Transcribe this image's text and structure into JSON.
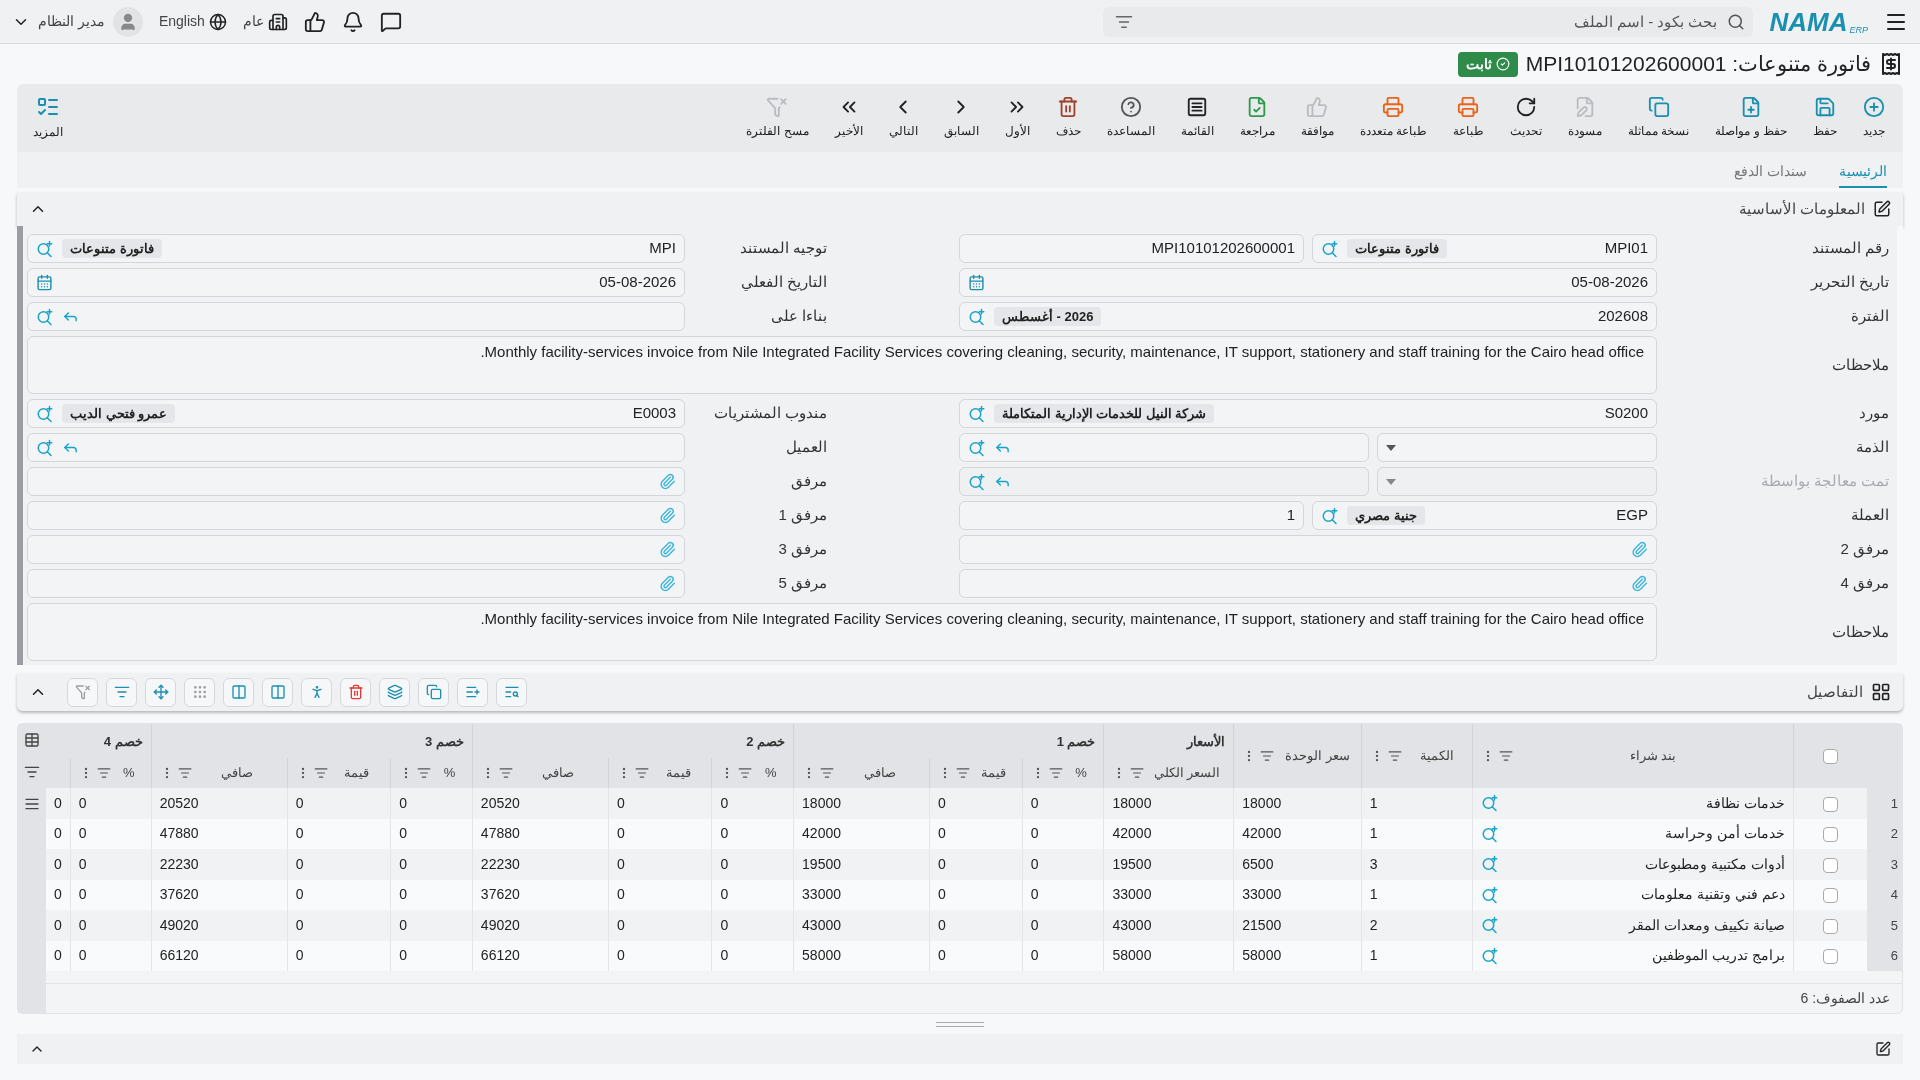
{
  "header": {
    "logo": "NAMA",
    "logo_sub": "ERP",
    "search": {
      "placeholder": "بحث بكود - اسم الملف"
    },
    "company": "عام",
    "language": "English",
    "user": "مدير النظام"
  },
  "page": {
    "title": "فاتورة متنوعات: MPI10101202600001",
    "status": "ثابت"
  },
  "toolbar": [
    {
      "label": "جديد",
      "color": "#1a8fb0"
    },
    {
      "label": "حفظ",
      "color": "#1a8fb0"
    },
    {
      "label": "حفظ و مواصلة",
      "color": "#1a8fb0"
    },
    {
      "label": "نسخة مماثلة",
      "color": "#1a8fb0"
    },
    {
      "label": "مسودة",
      "color": "#b9bcc1"
    },
    {
      "label": "تحديث",
      "color": "#222222"
    },
    {
      "label": "طباعة",
      "color": "#e8641b"
    },
    {
      "label": "طباعة متعددة",
      "color": "#e8641b"
    },
    {
      "label": "موافقة",
      "color": "#b9bcc1"
    },
    {
      "label": "مراجعة",
      "color": "#2e9a4a"
    },
    {
      "label": "القائمة",
      "color": "#222222"
    },
    {
      "label": "المساعدة",
      "color": "#555555"
    },
    {
      "label": "حذف",
      "color": "#a0402a"
    },
    {
      "label": "الأول",
      "color": "#222222"
    },
    {
      "label": "السابق",
      "color": "#222222"
    },
    {
      "label": "التالي",
      "color": "#222222"
    },
    {
      "label": "الأخير",
      "color": "#222222"
    },
    {
      "label": "مسح الفلترة",
      "color": "#b9bcc1"
    }
  ],
  "more": "المزيد",
  "tabs": [
    {
      "label": "الرئيسية",
      "selected": true
    },
    {
      "label": "سندات الدفع",
      "selected": false
    }
  ],
  "basic_info": {
    "title": "المعلومات الأساسية",
    "rows": [
      {
        "kind": "pair",
        "right": {
          "kind": "code",
          "label": "رقم المستند",
          "value": "MPI01",
          "tag": "فاتورة متنوعات",
          "second": "MPI10101202600001"
        },
        "left": {
          "kind": "code",
          "label": "توجيه المستند",
          "value": "MPI",
          "tag": "فاتورة متنوعات"
        }
      },
      {
        "kind": "pair",
        "right": {
          "kind": "date",
          "label": "تاريخ التحرير",
          "value": "05-08-2026"
        },
        "left": {
          "kind": "date",
          "label": "التاريخ الفعلي",
          "value": "05-08-2026"
        }
      },
      {
        "kind": "pair",
        "right": {
          "kind": "code",
          "label": "الفترة",
          "value": "202608",
          "tag": "2026 - أغسطس"
        },
        "left": {
          "kind": "link",
          "label": "بناءا على"
        }
      },
      {
        "kind": "notes",
        "label": "ملاحظات",
        "value": "Monthly facility-services invoice from Nile Integrated Facility Services covering cleaning, security, maintenance, IT support, stationery and staff training for the Cairo head office."
      },
      {
        "kind": "pair",
        "right": {
          "kind": "code",
          "label": "مورد",
          "value": "S0200",
          "tag": "شركة النيل للخدمات الإدارية المتكاملة"
        },
        "left": {
          "kind": "code",
          "label": "مندوب المشتريات",
          "value": "E0003",
          "tag": "عمرو فتحي الديب"
        }
      },
      {
        "kind": "pair",
        "right": {
          "kind": "select_link",
          "label": "الذمة",
          "disabled": false
        },
        "left": {
          "kind": "link",
          "label": "العميل"
        }
      },
      {
        "kind": "pair",
        "right": {
          "kind": "select_link",
          "label": "تمت معالجة بواسطة",
          "disabled": true
        },
        "left": {
          "kind": "attach",
          "label": "مرفق"
        }
      },
      {
        "kind": "pair",
        "right": {
          "kind": "code",
          "label": "العملة",
          "value": "EGP",
          "tag": "جنية مصري",
          "second": "1"
        },
        "left": {
          "kind": "attach",
          "label": "مرفق 1"
        }
      },
      {
        "kind": "pair",
        "right": {
          "kind": "attach",
          "label": "مرفق 2"
        },
        "left": {
          "kind": "attach",
          "label": "مرفق 3"
        }
      },
      {
        "kind": "pair",
        "right": {
          "kind": "attach",
          "label": "مرفق 4"
        },
        "left": {
          "kind": "attach",
          "label": "مرفق 5"
        }
      },
      {
        "kind": "notes",
        "label": "ملاحظات",
        "value": "Monthly facility-services invoice from Nile Integrated Facility Services covering cleaning, security, maintenance, IT support, stationery and staff training for the Cairo head office."
      }
    ]
  },
  "details": {
    "title": "التفاصيل",
    "table": {
      "all_checked": false,
      "columns": [
        {
          "label": "بند شراء"
        },
        {
          "label": "الكمية"
        },
        {
          "label": "سعر الوحدة"
        },
        {
          "label": "الأسعار",
          "children": [
            "السعر الكلي"
          ]
        },
        {
          "label": "خصم 1",
          "colspan": 3,
          "children": [
            "%",
            "قيمة",
            "صافي"
          ]
        },
        {
          "label": "خصم 2",
          "colspan": 3,
          "children": [
            "%",
            "قيمة",
            "صافي"
          ]
        },
        {
          "label": "خصم 3",
          "colspan": 3,
          "children": [
            "%",
            "قيمة",
            "صافي"
          ]
        },
        {
          "label": "خصم 4",
          "colspan": 2,
          "children": [
            "%"
          ]
        }
      ],
      "rows": [
        {
          "number": "1",
          "checked": false,
          "cells": [
            "خدمات نظافة",
            "1",
            "18000",
            "18000",
            "0",
            "0",
            "18000",
            "0",
            "0",
            "20520",
            "0",
            "0",
            "20520",
            "0",
            "0"
          ]
        },
        {
          "number": "2",
          "checked": false,
          "cells": [
            "خدمات أمن وحراسة",
            "1",
            "42000",
            "42000",
            "0",
            "0",
            "42000",
            "0",
            "0",
            "47880",
            "0",
            "0",
            "47880",
            "0",
            "0"
          ]
        },
        {
          "number": "3",
          "checked": false,
          "cells": [
            "أدوات مكتبية ومطبوعات",
            "3",
            "6500",
            "19500",
            "0",
            "0",
            "19500",
            "0",
            "0",
            "22230",
            "0",
            "0",
            "22230",
            "0",
            "0"
          ]
        },
        {
          "number": "4",
          "checked": false,
          "cells": [
            "دعم فني وتقنية معلومات",
            "1",
            "33000",
            "33000",
            "0",
            "0",
            "33000",
            "0",
            "0",
            "37620",
            "0",
            "0",
            "37620",
            "0",
            "0"
          ]
        },
        {
          "number": "5",
          "checked": false,
          "cells": [
            "صيانة تكييف ومعدات المقر",
            "2",
            "21500",
            "43000",
            "0",
            "0",
            "43000",
            "0",
            "0",
            "49020",
            "0",
            "0",
            "49020",
            "0",
            "0"
          ]
        },
        {
          "number": "6",
          "checked": false,
          "cells": [
            "برامج تدريب الموظفين",
            "1",
            "58000",
            "58000",
            "0",
            "0",
            "58000",
            "0",
            "0",
            "66120",
            "0",
            "0",
            "66120",
            "0",
            "0"
          ]
        }
      ],
      "row_count": "عدد الصفوف: 6"
    }
  }
}
